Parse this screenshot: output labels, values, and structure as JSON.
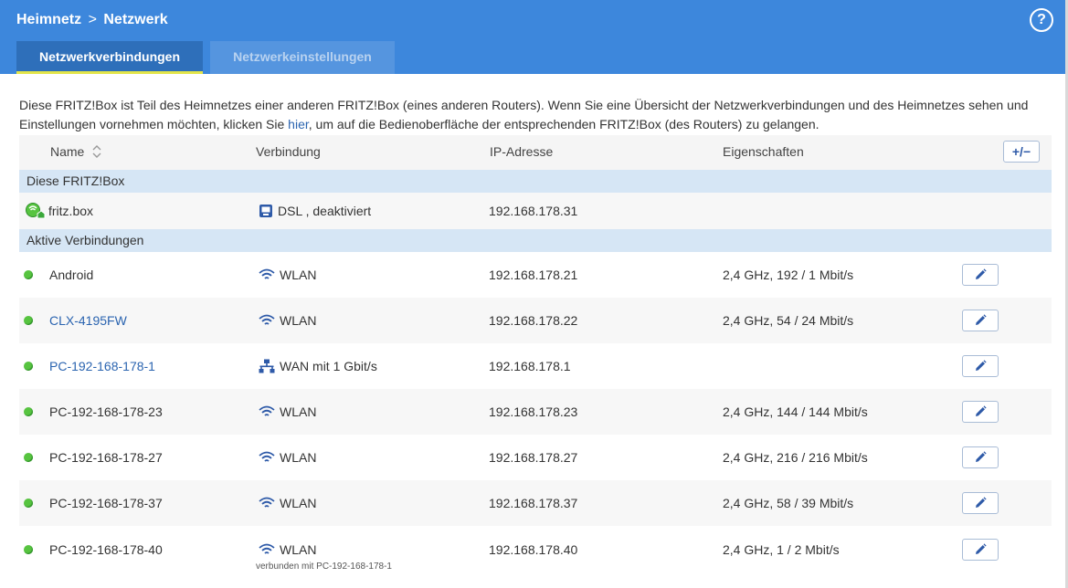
{
  "header": {
    "breadcrumb_parent": "Heimnetz",
    "breadcrumb_sep": ">",
    "breadcrumb_current": "Netzwerk",
    "help": "?"
  },
  "tabs": [
    {
      "label": "Netzwerkverbindungen",
      "active": true
    },
    {
      "label": "Netzwerkeinstellungen",
      "active": false
    }
  ],
  "intro": {
    "before": "Diese FRITZ!Box ist Teil des Heimnetzes einer anderen FRITZ!Box (eines anderen Routers). Wenn Sie eine Übersicht der Netzwerkverbindungen und des Heimnetzes sehen und Einstellungen vornehmen möchten, klicken Sie ",
    "link": "hier",
    "after": ", um auf die Bedienoberfläche der entsprechenden FRITZ!Box (des Routers) zu gelangen."
  },
  "table": {
    "columns": [
      "Name",
      "Verbindung",
      "IP-Adresse",
      "Eigenschaften"
    ],
    "column_toggle": "+/−",
    "section_box": "Diese FRITZ!Box",
    "box_row": {
      "name": "fritz.box",
      "connection": "DSL , deaktiviert",
      "ip": "192.168.178.31",
      "icon": "fritzbox-icon",
      "conn_icon": "dsl-icon"
    },
    "section_active": "Aktive Verbindungen",
    "rows": [
      {
        "name": "Android",
        "connection": "WLAN",
        "ip": "192.168.178.21",
        "properties": "2,4 GHz, 192 / 1 Mbit/s",
        "link": false,
        "conn_icon": "wifi-icon"
      },
      {
        "name": "CLX-4195FW",
        "connection": "WLAN",
        "ip": "192.168.178.22",
        "properties": "2,4 GHz, 54 / 24 Mbit/s",
        "link": true,
        "conn_icon": "wifi-icon"
      },
      {
        "name": "PC-192-168-178-1",
        "connection": "WAN mit 1 Gbit/s",
        "ip": "192.168.178.1",
        "properties": "",
        "link": true,
        "conn_icon": "lan-icon"
      },
      {
        "name": "PC-192-168-178-23",
        "connection": "WLAN",
        "ip": "192.168.178.23",
        "properties": "2,4 GHz, 144 / 144 Mbit/s",
        "link": false,
        "conn_icon": "wifi-icon"
      },
      {
        "name": "PC-192-168-178-27",
        "connection": "WLAN",
        "ip": "192.168.178.27",
        "properties": "2,4 GHz, 216 / 216 Mbit/s",
        "link": false,
        "conn_icon": "wifi-icon"
      },
      {
        "name": "PC-192-168-178-37",
        "connection": "WLAN",
        "ip": "192.168.178.37",
        "properties": "2,4 GHz, 58 / 39 Mbit/s",
        "link": false,
        "conn_icon": "wifi-icon"
      },
      {
        "name": "PC-192-168-178-40",
        "connection": "WLAN",
        "ip": "192.168.178.40",
        "properties": "2,4 GHz, 1 / 2 Mbit/s",
        "link": false,
        "conn_icon": "wifi-icon",
        "note": "verbunden mit PC-192-168-178-1"
      }
    ]
  },
  "colors": {
    "header": "#3d87dc",
    "tab_active": "#2e6fba",
    "tab_underline": "#e3e54a",
    "link": "#2b64b0",
    "online": "#57c440",
    "section": "#d6e6f5"
  }
}
